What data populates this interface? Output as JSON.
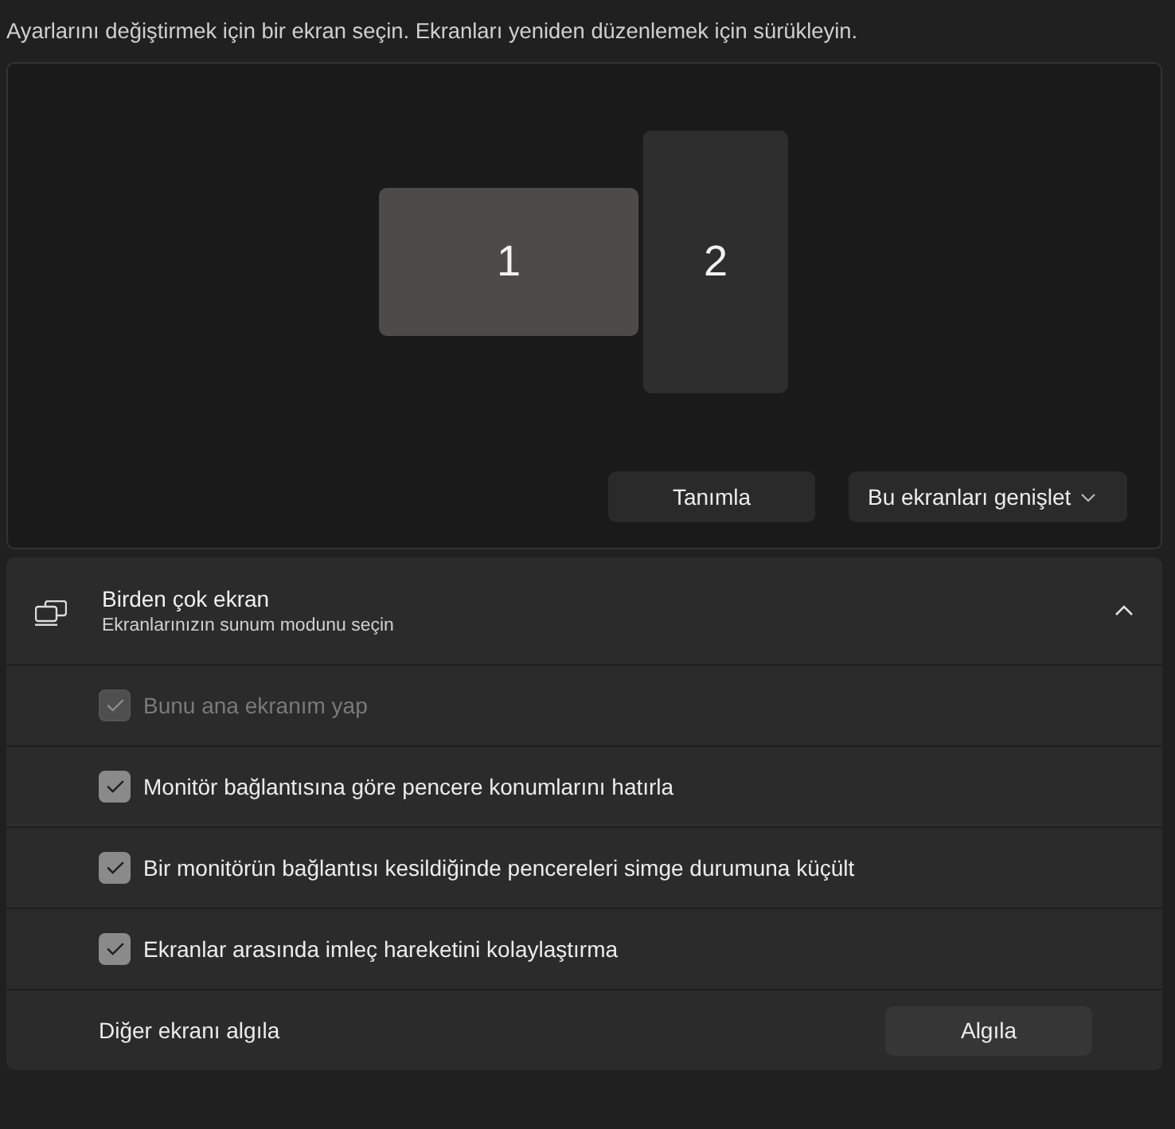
{
  "instruction": "Ayarlarını değiştirmek için bir ekran seçin. Ekranları yeniden düzenlemek için sürükleyin.",
  "arrangement": {
    "displays": [
      {
        "label": "1",
        "selected": true
      },
      {
        "label": "2",
        "selected": false
      }
    ],
    "identify_button": "Tanımla",
    "mode_dropdown": {
      "value": "Bu ekranları genişlet"
    }
  },
  "multiple_displays": {
    "title": "Birden çok ekran",
    "subtitle": "Ekranlarınızın sunum modunu seçin",
    "expanded": true,
    "options": [
      {
        "label": "Bunu ana ekranım yap",
        "checked": true,
        "disabled": true
      },
      {
        "label": "Monitör bağlantısına göre pencere konumlarını hatırla",
        "checked": true,
        "disabled": false
      },
      {
        "label": "Bir monitörün bağlantısı kesildiğinde pencereleri simge durumuna küçült",
        "checked": true,
        "disabled": false
      },
      {
        "label": "Ekranlar arasında imleç hareketini kolaylaştırma",
        "checked": true,
        "disabled": false
      }
    ],
    "detect": {
      "label": "Diğer ekranı algıla",
      "button": "Algıla"
    }
  }
}
